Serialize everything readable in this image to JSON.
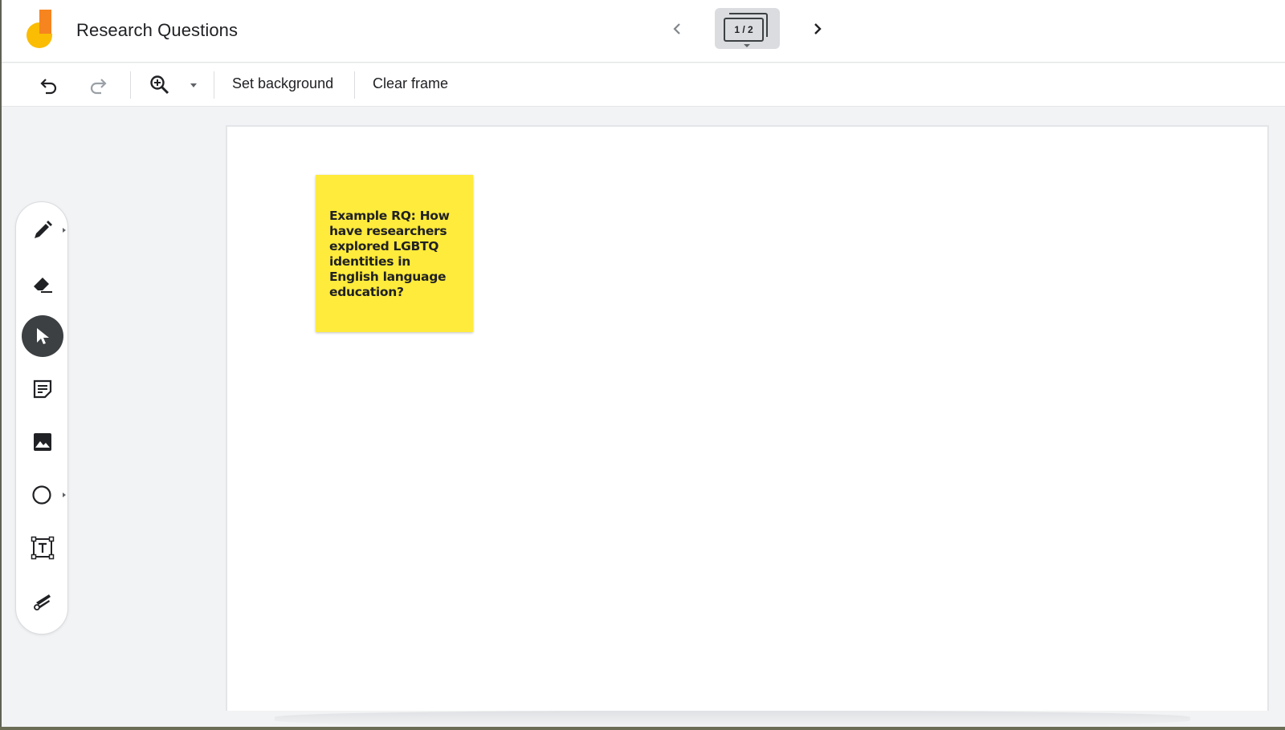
{
  "header": {
    "title": "Research Questions",
    "frame_indicator": "1 / 2",
    "prev_icon": "chevron-left-icon",
    "next_icon": "chevron-right-icon"
  },
  "toolbar": {
    "undo_icon": "undo-icon",
    "redo_icon": "redo-icon",
    "zoom_icon": "zoom-in-icon",
    "set_background_label": "Set background",
    "clear_frame_label": "Clear frame"
  },
  "tools": [
    {
      "name": "pen-tool",
      "icon": "pen-icon"
    },
    {
      "name": "eraser-tool",
      "icon": "eraser-icon"
    },
    {
      "name": "select-tool",
      "icon": "pointer-icon",
      "active": true
    },
    {
      "name": "sticky-note-tool",
      "icon": "sticky-note-icon"
    },
    {
      "name": "image-tool",
      "icon": "image-icon"
    },
    {
      "name": "shape-tool",
      "icon": "circle-icon"
    },
    {
      "name": "text-box-tool",
      "icon": "text-box-icon"
    },
    {
      "name": "laser-tool",
      "icon": "laser-icon"
    }
  ],
  "canvas": {
    "sticky_note": {
      "text": "Example RQ: How have researchers explored LGBTQ identities in English language education?",
      "color": "#ffeb3b"
    }
  },
  "colors": {
    "logo_yellow": "#fbbc04",
    "logo_orange": "#f6841f",
    "active_tool": "#3c4043"
  }
}
